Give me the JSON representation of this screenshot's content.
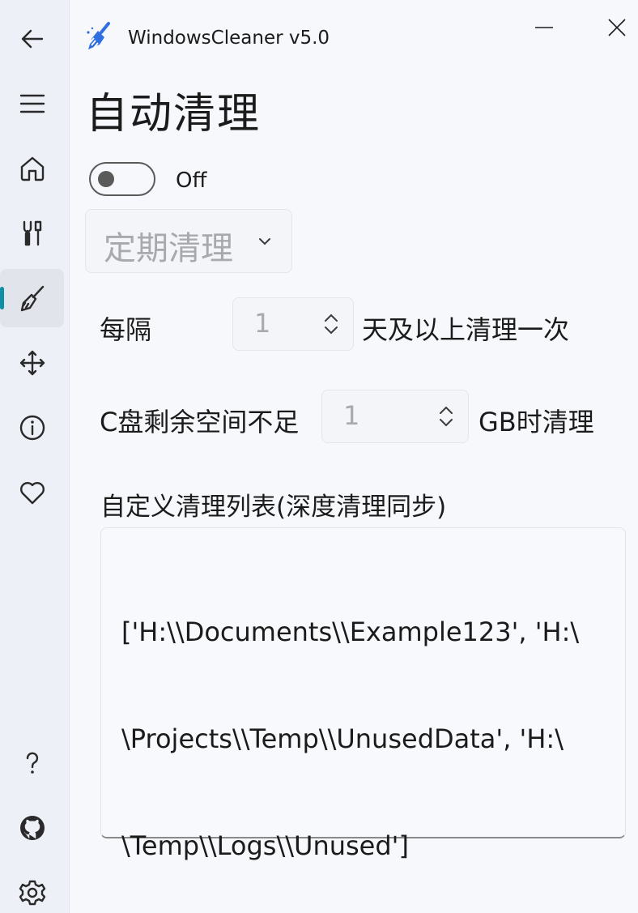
{
  "window": {
    "title": "WindowsCleaner v5.0"
  },
  "nav": {
    "items": [
      {
        "icon": "back-arrow-icon"
      },
      {
        "icon": "hamburger-menu-icon"
      },
      {
        "icon": "home-icon"
      },
      {
        "icon": "tools-icon"
      },
      {
        "icon": "broom-icon",
        "selected": true
      },
      {
        "icon": "move-arrows-icon"
      },
      {
        "icon": "info-icon"
      },
      {
        "icon": "heart-icon"
      },
      {
        "icon": "help-icon"
      },
      {
        "icon": "github-icon"
      },
      {
        "icon": "settings-gear-icon"
      }
    ],
    "accent_color": "#0f8fa3"
  },
  "page": {
    "title": "自动清理",
    "toggle": {
      "state": "Off",
      "on": false
    },
    "mode_combo": {
      "value": "定期清理"
    },
    "interval": {
      "label_before": "每隔",
      "value": "1",
      "label_after": "天及以上清理一次"
    },
    "disk": {
      "label_before": "C盘剩余空间不足",
      "value": "1",
      "label_after": "GB时清理"
    },
    "custom_list": {
      "label": "自定义清理列表(深度清理同步)",
      "lines": [
        "['H:\\\\Documents\\\\Example123', 'H:\\",
        "\\Projects\\\\Temp\\\\UnusedData', 'H:\\",
        "\\Temp\\\\Logs\\\\Unused']"
      ]
    }
  }
}
